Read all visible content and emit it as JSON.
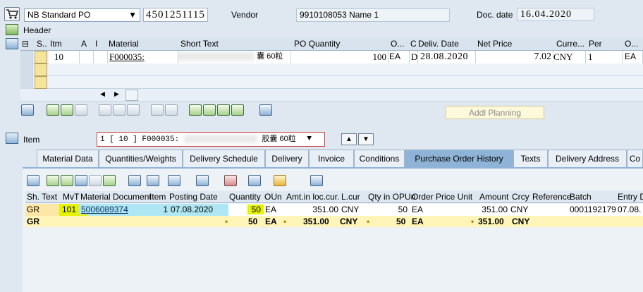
{
  "po_header": {
    "po_type": "NB Standard PO",
    "po_number": "4501251115",
    "vendor_label": "Vendor",
    "vendor_value": "9910108053 Name 1",
    "doc_date_label": "Doc. date",
    "doc_date_value": "16.04.2020",
    "header_label": "Header"
  },
  "items_grid": {
    "columns": [
      "S..",
      "Itm",
      "A",
      "I",
      "Material",
      "Short Text",
      "PO Quantity",
      "O...",
      "C",
      "Deliv. Date",
      "Net Price",
      "Curre...",
      "Per",
      "O..."
    ],
    "row": {
      "itm": "10",
      "material": "F000035:",
      "short_text_suffix": "囊 60粒",
      "po_quantity": "100",
      "order_unit": "EA",
      "cat": "D",
      "deliv_date": "28.08.2020",
      "net_price": "7.02",
      "currency": "CNY",
      "per": "1",
      "order_unit2": "EA"
    },
    "addl_planning_label": "Addl Planning"
  },
  "item_bar": {
    "label": "Item",
    "selector_prefix": "1 [ 10 ] F000035:",
    "selector_suffix": "胶囊 60粒"
  },
  "tabs": [
    "Material Data",
    "Quantities/Weights",
    "Delivery Schedule",
    "Delivery",
    "Invoice",
    "Conditions",
    "Purchase Order History",
    "Texts",
    "Delivery Address",
    "Co"
  ],
  "history_grid": {
    "columns": [
      "Sh. Text",
      "MvT",
      "Material Document",
      "Item",
      "Posting Date",
      "Quantity",
      "OUn",
      "Amt.in loc.cur.",
      "L.cur",
      "Qty in OPUn",
      "Order Price Unit",
      "Amount",
      "Crcy",
      "Reference",
      "Batch",
      "Entry D"
    ],
    "rows": [
      {
        "sh_text": "GR",
        "mvt": "101",
        "mat_doc": "5006089374",
        "item": "1",
        "posting_date": "07.08.2020",
        "quantity": "50",
        "oun": "EA",
        "amt_loc": "351.00",
        "lcur": "CNY",
        "qty_opun": "50",
        "opu": "EA",
        "amount": "351.00",
        "crcy": "CNY",
        "reference": "",
        "batch": "0001192179",
        "entry_date": "07.08."
      }
    ],
    "total": {
      "sh_text": "GR",
      "quantity": "50",
      "oun": "EA",
      "amt_loc": "351.00",
      "lcur": "CNY",
      "qty_opun": "50",
      "opu": "EA",
      "amount": "351.00",
      "crcy": "CNY",
      "dot": "•"
    }
  }
}
